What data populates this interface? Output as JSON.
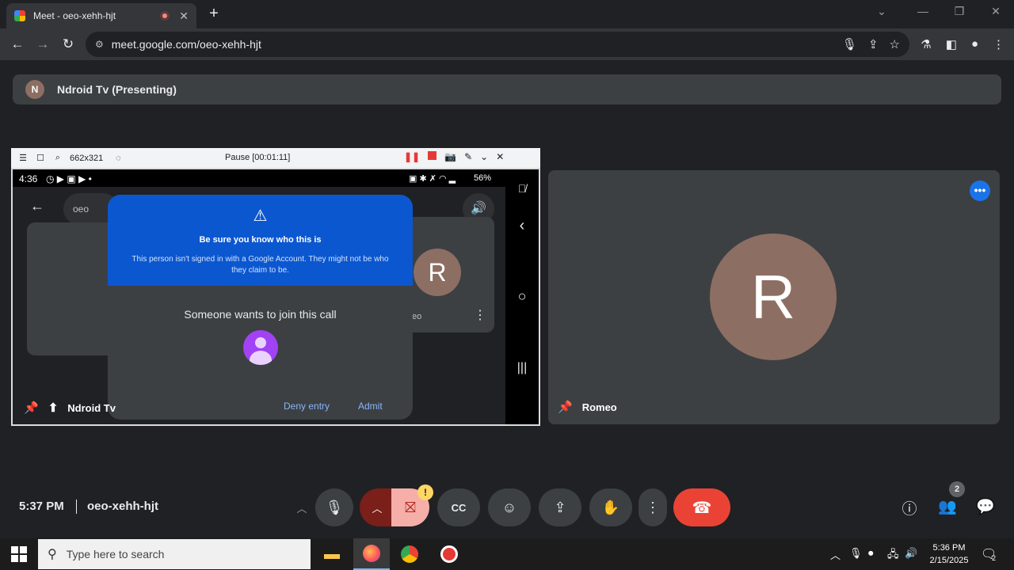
{
  "browser": {
    "tab_title": "Meet - oeo-xehh-hjt",
    "tab_close": "✕",
    "new_tab": "+",
    "url": "meet.google.com/oeo-xehh-hjt"
  },
  "meet": {
    "presenter_initial": "N",
    "presenting_label": "Ndroid Tv (Presenting)",
    "time": "5:37 PM",
    "meeting_code": "oeo-xehh-hjt",
    "people_count": "2"
  },
  "share_toolbar": {
    "dimensions": "662x321",
    "pause_status": "Pause [00:01:11]"
  },
  "phone": {
    "time": "4:36",
    "battery": "56%",
    "pill_text": "oeo",
    "tile_initial": "R",
    "tile_name": "eo"
  },
  "dialog": {
    "warning_title": "Be sure you know who this is",
    "warning_body": "This person isn't signed in with a Google Account. They might not be who they claim to be.",
    "prompt": "Someone wants to join this call",
    "deny_label": "Deny entry",
    "admit_label": "Admit"
  },
  "tiles": {
    "share_tile_name": "Ndroid Tv",
    "person_tile_name": "Romeo",
    "person_initial": "R"
  },
  "taskbar": {
    "search_placeholder": "Type here to search",
    "clock_time": "5:36 PM",
    "clock_date": "2/15/2025",
    "notification_count": "2"
  },
  "colors": {
    "hangup": "#ea4335",
    "camera_off": "#f6aea9",
    "avatar_brown": "#8d6e63",
    "warning_blue": "#0b57d0"
  },
  "icons": [
    "back-arrow-icon",
    "forward-arrow-icon",
    "reload-icon",
    "mic-icon",
    "share-icon",
    "star-icon",
    "pin-icon",
    "present-icon",
    "hand-icon",
    "emoji-icon",
    "captions-icon",
    "hangup-icon",
    "info-icon",
    "people-icon",
    "chat-icon"
  ]
}
